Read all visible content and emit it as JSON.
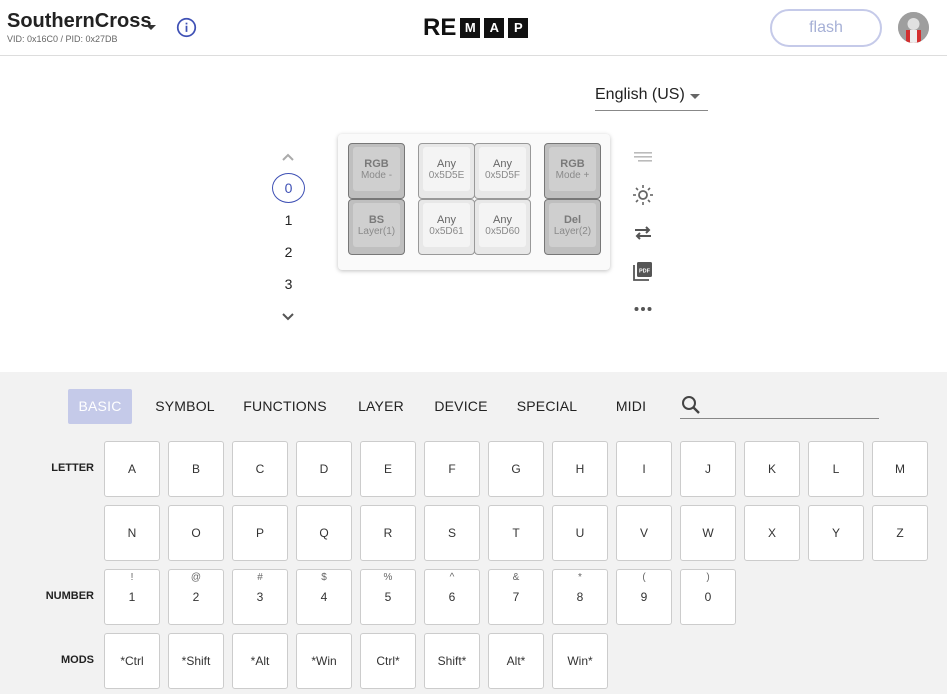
{
  "header": {
    "keyboard_name": "SouthernCross",
    "keyboard_ids": "VID: 0x16C0 / PID: 0x27DB",
    "logo_text": "RE",
    "logo_boxes": [
      "M",
      "A",
      "P"
    ],
    "flash_label": "flash"
  },
  "language": {
    "label": "English (US)"
  },
  "layers": {
    "items": [
      "0",
      "1",
      "2",
      "3"
    ],
    "active": "0"
  },
  "keymap": {
    "keys": [
      {
        "top": "RGB",
        "bottom": "Mode -"
      },
      {
        "top": "Any",
        "bottom": "0x5D5E"
      },
      {
        "top": "Any",
        "bottom": "0x5D5F"
      },
      {
        "top": "RGB",
        "bottom": "Mode +"
      },
      {
        "top": "BS",
        "bottom": "Layer(1)"
      },
      {
        "top": "Any",
        "bottom": "0x5D61"
      },
      {
        "top": "Any",
        "bottom": "0x5D60"
      },
      {
        "top": "Del",
        "bottom": "Layer(2)"
      }
    ]
  },
  "tools": [
    "notes-icon",
    "light-icon",
    "swap-icon",
    "pdf-icon",
    "more-icon"
  ],
  "categories": {
    "tabs": [
      "BASIC",
      "SYMBOL",
      "FUNCTIONS",
      "LAYER",
      "DEVICE",
      "SPECIAL",
      "MIDI"
    ],
    "active": "BASIC",
    "search_placeholder": ""
  },
  "keycodes": {
    "letter_label": "LETTER",
    "letters_row1": [
      "A",
      "B",
      "C",
      "D",
      "E",
      "F",
      "G",
      "H",
      "I",
      "J",
      "K",
      "L",
      "M"
    ],
    "letters_row2": [
      "N",
      "O",
      "P",
      "Q",
      "R",
      "S",
      "T",
      "U",
      "V",
      "W",
      "X",
      "Y",
      "Z"
    ],
    "number_label": "NUMBER",
    "numbers": [
      {
        "shift": "!",
        "key": "1"
      },
      {
        "shift": "@",
        "key": "2"
      },
      {
        "shift": "#",
        "key": "3"
      },
      {
        "shift": "$",
        "key": "4"
      },
      {
        "shift": "%",
        "key": "5"
      },
      {
        "shift": "^",
        "key": "6"
      },
      {
        "shift": "&",
        "key": "7"
      },
      {
        "shift": "*",
        "key": "8"
      },
      {
        "shift": "(",
        "key": "9"
      },
      {
        "shift": ")",
        "key": "0"
      }
    ],
    "mods_label": "MODS",
    "mods": [
      "*Ctrl",
      "*Shift",
      "*Alt",
      "*Win",
      "Ctrl*",
      "Shift*",
      "Alt*",
      "Win*"
    ]
  },
  "colors": {
    "accent": "#3f51b5",
    "tab_active_bg": "#c5cae9",
    "panel_bg": "#f2f2f2"
  }
}
